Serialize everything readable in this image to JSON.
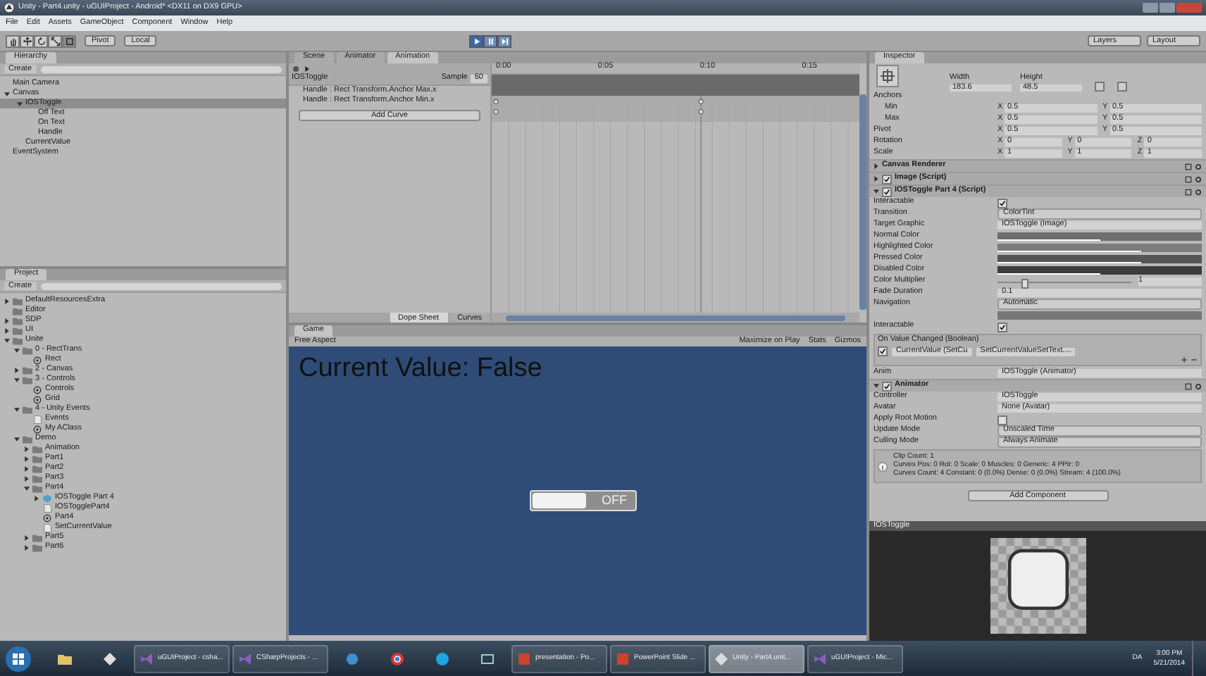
{
  "window": {
    "title": "Unity - Part4.unity - uGUIProject - Android* <DX11 on DX9 GPU>"
  },
  "menu": [
    "File",
    "Edit",
    "Assets",
    "GameObject",
    "Component",
    "Window",
    "Help"
  ],
  "toolbar": {
    "tools": [
      {
        "kind": "hand",
        "selected": false
      },
      {
        "kind": "move",
        "selected": false
      },
      {
        "kind": "rotate",
        "selected": false
      },
      {
        "kind": "scale",
        "selected": false
      },
      {
        "kind": "rect",
        "selected": true
      }
    ],
    "pivot": "Pivot",
    "space": "Local",
    "play": [
      {
        "kind": "play",
        "selected": true
      },
      {
        "kind": "pause",
        "selected": false
      },
      {
        "kind": "step",
        "selected": false
      }
    ],
    "layers": "Layers",
    "layout": "Layout"
  },
  "hierarchy": {
    "title": "Hierarchy",
    "create": "Create",
    "items": [
      {
        "label": "Main Camera",
        "selected": false
      },
      {
        "label": "Canvas",
        "selected": false,
        "expanded": true,
        "children": [
          {
            "label": "IOSToggle",
            "selected": true,
            "expanded": true,
            "children": [
              {
                "label": "Off Text",
                "selected": false
              },
              {
                "label": "On Text",
                "selected": false
              },
              {
                "label": "Handle",
                "selected": false
              }
            ]
          },
          {
            "label": "CurrentValue",
            "selected": false
          }
        ]
      },
      {
        "label": "EventSystem",
        "selected": false
      }
    ]
  },
  "project": {
    "title": "Project",
    "create": "Create",
    "items": [
      {
        "label": "DefaultResourcesExtra",
        "kind": "folder",
        "selected": false,
        "expanded": false
      },
      {
        "label": "Editor",
        "kind": "folder",
        "selected": false
      },
      {
        "label": "SDP",
        "kind": "folder",
        "selected": false,
        "expanded": false
      },
      {
        "label": "UI",
        "kind": "folder",
        "selected": false,
        "expanded": false
      },
      {
        "label": "Unite",
        "kind": "folder",
        "selected": false,
        "expanded": true,
        "children": [
          {
            "label": "0 - RectTrans",
            "kind": "folder",
            "selected": false,
            "expanded": true,
            "children": [
              {
                "label": "Rect",
                "kind": "scene",
                "selected": false
              }
            ]
          },
          {
            "label": "2 - Canvas",
            "kind": "folder",
            "selected": false,
            "expanded": false
          },
          {
            "label": "3 - Controls",
            "kind": "folder",
            "selected": false,
            "expanded": true,
            "children": [
              {
                "label": "Controls",
                "kind": "scene",
                "selected": false
              },
              {
                "label": "Grid",
                "kind": "scene",
                "selected": false
              }
            ]
          },
          {
            "label": "4 - Unity Events",
            "kind": "folder",
            "selected": false,
            "expanded": true,
            "children": [
              {
                "label": "Events",
                "kind": "script",
                "selected": false
              },
              {
                "label": "My AClass",
                "kind": "scene",
                "selected": false
              }
            ]
          },
          {
            "label": "Demo",
            "kind": "folder",
            "selected": false,
            "expanded": true,
            "children": [
              {
                "label": "Animation",
                "kind": "folder",
                "selected": false,
                "expanded": false
              },
              {
                "label": "Part1",
                "kind": "folder",
                "selected": false,
                "expanded": false
              },
              {
                "label": "Part2",
                "kind": "folder",
                "selected": false,
                "expanded": false
              },
              {
                "label": "Part3",
                "kind": "folder",
                "selected": false,
                "expanded": false
              },
              {
                "label": "Part4",
                "kind": "folder",
                "selected": false,
                "expanded": true,
                "children": [
                  {
                    "label": "IOSToggle Part 4",
                    "kind": "prefab",
                    "selected": false,
                    "expanded": false
                  },
                  {
                    "label": "IOSTogglePart4",
                    "kind": "script",
                    "selected": false
                  },
                  {
                    "label": "Part4",
                    "kind": "scene",
                    "selected": false
                  },
                  {
                    "label": "SetCurrentValue",
                    "kind": "script",
                    "selected": false
                  }
                ]
              },
              {
                "label": "Part5",
                "kind": "folder",
                "selected": false,
                "expanded": false
              },
              {
                "label": "Part6",
                "kind": "folder",
                "selected": false,
                "expanded": false
              }
            ]
          }
        ]
      }
    ]
  },
  "center_tabs": [
    {
      "label": "Scene",
      "selected": false
    },
    {
      "label": "Animator",
      "selected": false
    },
    {
      "label": "Animation",
      "selected": true
    }
  ],
  "animation": {
    "clip": "IOSToggle",
    "sample_label": "Sample",
    "sample": "60",
    "curves": [
      "Handle : Rect Transform.Anchor Max.x",
      "Handle : Rect Transform.Anchor Min.x"
    ],
    "add_curve": "Add Curve",
    "ruler": [
      "0:00",
      "0:05",
      "0:10",
      "0:15"
    ],
    "views": [
      {
        "label": "Dope Sheet",
        "selected": true
      },
      {
        "label": "Curves",
        "selected": false
      }
    ]
  },
  "game": {
    "tab": "Game",
    "aspect": "Free Aspect",
    "options": [
      "Maximize on Play",
      "Stats",
      "Gizmos"
    ],
    "heading": "Current Value: False",
    "toggle": {
      "label": "OFF",
      "on": false
    }
  },
  "inspector": {
    "title": "Inspector",
    "size_fields": [
      {
        "label": "Width",
        "value": "183.6"
      },
      {
        "label": "Height",
        "value": "48.5"
      }
    ],
    "anchors": "Anchors",
    "vectors": [
      {
        "label": "Min",
        "kind": "sub",
        "fields": [
          {
            "axis": "X",
            "value": "0.5"
          },
          {
            "axis": "Y",
            "value": "0.5"
          }
        ]
      },
      {
        "label": "Max",
        "kind": "sub",
        "fields": [
          {
            "axis": "X",
            "value": "0.5"
          },
          {
            "axis": "Y",
            "value": "0.5"
          }
        ]
      },
      {
        "label": "Pivot",
        "kind": "main",
        "fields": [
          {
            "axis": "X",
            "value": "0.5"
          },
          {
            "axis": "Y",
            "value": "0.5"
          }
        ]
      },
      {
        "label": "Rotation",
        "kind": "main",
        "fields": [
          {
            "axis": "X",
            "value": "0"
          },
          {
            "axis": "Y",
            "value": "0"
          },
          {
            "axis": "Z",
            "value": "0"
          }
        ]
      },
      {
        "label": "Scale",
        "kind": "main",
        "fields": [
          {
            "axis": "X",
            "value": "1"
          },
          {
            "axis": "Y",
            "value": "1"
          },
          {
            "axis": "Z",
            "value": "1"
          }
        ]
      }
    ],
    "components": [
      {
        "name": "Canvas Renderer",
        "expanded": false
      },
      {
        "name": "Image (Script)",
        "expanded": false,
        "enabled": true
      },
      {
        "name": "IOSToggle Part 4 (Script)",
        "expanded": true,
        "enabled": true,
        "properties": [
          {
            "kind": "check",
            "label": "Interactable",
            "checked": true
          },
          {
            "kind": "dropdown",
            "label": "Transition",
            "value": "ColorTint"
          },
          {
            "kind": "object",
            "label": "Target Graphic",
            "value": "IOSToggle (Image)"
          },
          {
            "kind": "color",
            "label": "Normal Color",
            "color": "#6e6e6e",
            "level": 0.5
          },
          {
            "kind": "color",
            "label": "Highlighted Color",
            "color": "#7c7c7c",
            "level": 0.7
          },
          {
            "kind": "color",
            "label": "Pressed Color",
            "color": "#555555",
            "level": 0.7
          },
          {
            "kind": "color",
            "label": "Disabled Color",
            "color": "#3c3c3c",
            "level": 0.5
          },
          {
            "kind": "slider",
            "label": "Color Multiplier",
            "level": 0.2,
            "value": "1"
          },
          {
            "kind": "text",
            "label": "Fade Duration",
            "value": "0.1"
          },
          {
            "kind": "dropdown",
            "label": "Navigation",
            "value": "Automatic"
          },
          {
            "kind": "bar"
          },
          {
            "kind": "check",
            "label": "Interactable",
            "checked": true
          },
          {
            "kind": "event",
            "title": "On Value Changed (Boolean)",
            "checked": true,
            "target": "CurrentValue (SetCu",
            "method": "SetCurrentValueSetText...."
          },
          {
            "kind": "object",
            "label": "Anim",
            "value": "IOSToggle (Animator)"
          }
        ]
      },
      {
        "name": "Animator",
        "expanded": true,
        "enabled": true,
        "properties": [
          {
            "kind": "object",
            "label": "Controller",
            "value": "IOSToggle"
          },
          {
            "kind": "object",
            "label": "Avatar",
            "value": "None (Avatar)"
          },
          {
            "kind": "check",
            "label": "Apply Root Motion",
            "checked": false
          },
          {
            "kind": "dropdown",
            "label": "Update Mode",
            "value": "Unscaled Time"
          },
          {
            "kind": "dropdown",
            "label": "Culling Mode",
            "value": "Always Animate"
          },
          {
            "kind": "info",
            "lines": [
              "Clip Count: 1",
              "Curves Pos: 0 Rot: 0 Scale: 0 Muscles: 0 Generic: 4 PPtr: 0",
              "Curves Count: 4 Constant: 0 (0.0%) Dense: 0 (0.0%) Stream: 4 (100.0%)"
            ]
          }
        ]
      }
    ],
    "add_component": "Add Component"
  },
  "preview": {
    "title": "IOSToggle"
  },
  "taskbar": {
    "items": [
      {
        "kind": "folder",
        "selected": false
      },
      {
        "kind": "unity",
        "selected": false
      },
      {
        "kind": "vs",
        "label": "uGUIProject - csha...",
        "selected": false
      },
      {
        "kind": "vs",
        "label": "CSharpProjects - ...",
        "selected": false
      },
      {
        "kind": "mail",
        "selected": false
      },
      {
        "kind": "chrome",
        "selected": false
      },
      {
        "kind": "skype",
        "selected": false
      },
      {
        "kind": "monitor",
        "selected": false
      },
      {
        "kind": "ppt",
        "label": "presentation - Po...",
        "selected": false
      },
      {
        "kind": "ppt",
        "label": "PowerPoint Slide ...",
        "selected": false
      },
      {
        "kind": "unity",
        "label": "Unity - Part4.unit...",
        "selected": true
      },
      {
        "kind": "vs",
        "label": "uGUIProject - Mic...",
        "selected": false
      }
    ],
    "language": "DA",
    "time": "3:00 PM",
    "date": "5/21/2014"
  }
}
